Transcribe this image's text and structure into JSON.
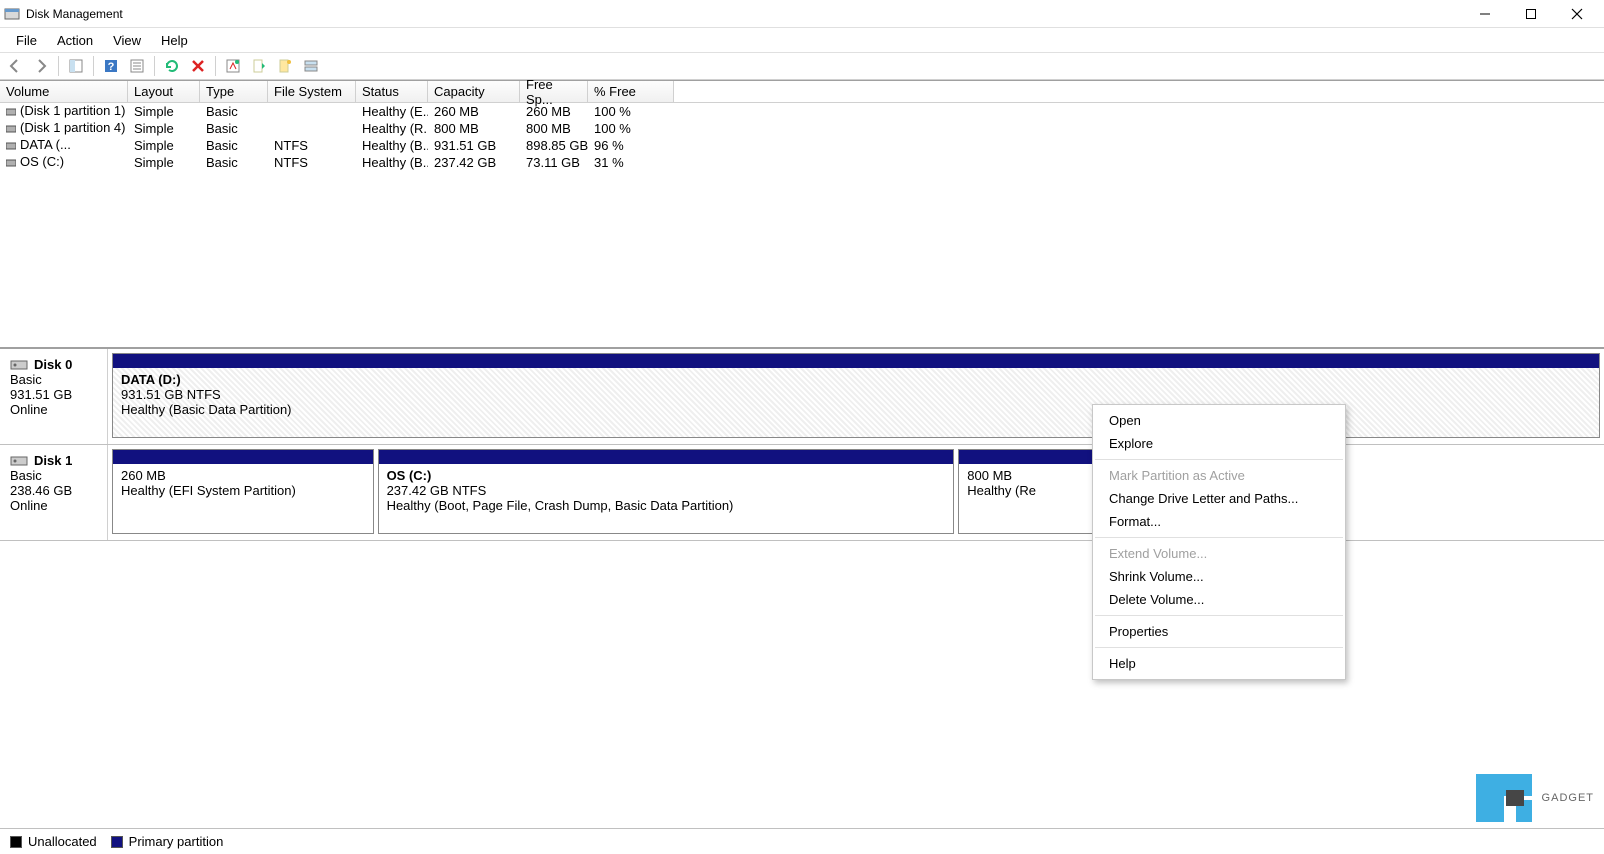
{
  "window": {
    "title": "Disk Management"
  },
  "menubar": {
    "items": [
      "File",
      "Action",
      "View",
      "Help"
    ]
  },
  "columns": {
    "volume": "Volume",
    "layout": "Layout",
    "type": "Type",
    "fs": "File System",
    "status": "Status",
    "capacity": "Capacity",
    "free": "Free Sp...",
    "pct": "% Free"
  },
  "volumes": [
    {
      "name": "(Disk 1 partition 1)",
      "layout": "Simple",
      "type": "Basic",
      "fs": "",
      "status": "Healthy (E...",
      "capacity": "260 MB",
      "free": "260 MB",
      "pct": "100 %"
    },
    {
      "name": "(Disk 1 partition 4)",
      "layout": "Simple",
      "type": "Basic",
      "fs": "",
      "status": "Healthy (R...",
      "capacity": "800 MB",
      "free": "800 MB",
      "pct": "100 %"
    },
    {
      "name": "DATA (...",
      "layout": "Simple",
      "type": "Basic",
      "fs": "NTFS",
      "status": "Healthy (B...",
      "capacity": "931.51 GB",
      "free": "898.85 GB",
      "pct": "96 %"
    },
    {
      "name": "OS (C:)",
      "layout": "Simple",
      "type": "Basic",
      "fs": "NTFS",
      "status": "Healthy (B...",
      "capacity": "237.42 GB",
      "free": "73.11 GB",
      "pct": "31 %"
    }
  ],
  "disks": [
    {
      "name": "Disk 0",
      "type": "Basic",
      "size": "931.51 GB",
      "state": "Online",
      "partitions": [
        {
          "title": "DATA  (D:)",
          "line2": "931.51 GB NTFS",
          "line3": "Healthy (Basic Data Partition)",
          "hatched": true,
          "flex": 1
        }
      ]
    },
    {
      "name": "Disk 1",
      "type": "Basic",
      "size": "238.46 GB",
      "state": "Online",
      "partitions": [
        {
          "title": "",
          "line2": "260 MB",
          "line3": "Healthy (EFI System Partition)",
          "hatched": false,
          "flex": 0.21
        },
        {
          "title": "OS  (C:)",
          "line2": "237.42 GB NTFS",
          "line3": "Healthy (Boot, Page File, Crash Dump, Basic Data Partition)",
          "hatched": false,
          "flex": 0.465
        },
        {
          "title": "",
          "line2": "800 MB",
          "line3": "Healthy (Re",
          "hatched": false,
          "flex": 0.25
        }
      ]
    }
  ],
  "legend": {
    "unallocated": "Unallocated",
    "primary": "Primary partition"
  },
  "context_menu": {
    "items": [
      {
        "label": "Open",
        "enabled": true
      },
      {
        "label": "Explore",
        "enabled": true
      },
      {
        "sep": true
      },
      {
        "label": "Mark Partition as Active",
        "enabled": false
      },
      {
        "label": "Change Drive Letter and Paths...",
        "enabled": true
      },
      {
        "label": "Format...",
        "enabled": true
      },
      {
        "sep": true
      },
      {
        "label": "Extend Volume...",
        "enabled": false
      },
      {
        "label": "Shrink Volume...",
        "enabled": true
      },
      {
        "label": "Delete Volume...",
        "enabled": true
      },
      {
        "sep": true
      },
      {
        "label": "Properties",
        "enabled": true
      },
      {
        "sep": true
      },
      {
        "label": "Help",
        "enabled": true
      }
    ]
  },
  "watermark": {
    "text": "GADGET"
  },
  "colors": {
    "partition_bar": "#11117f",
    "legend_unallocated": "#000000",
    "legend_primary": "#11117f"
  }
}
